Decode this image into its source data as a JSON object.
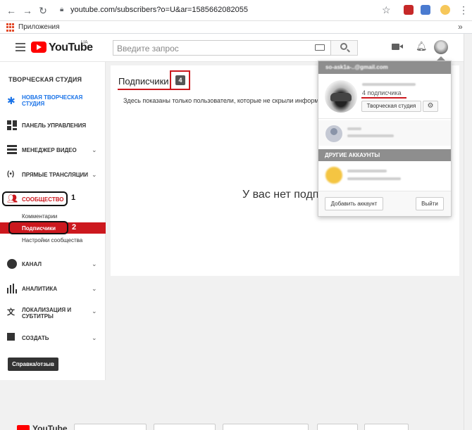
{
  "browser": {
    "url": "youtube.com/subscribers?o=U&ar=1585662082055",
    "bookmarks_label": "Приложения",
    "more_glyph": "»"
  },
  "header": {
    "logo_text": "YouTube",
    "logo_region": "UA",
    "search_placeholder": "Введите запрос"
  },
  "sidebar": {
    "title": "ТВОРЧЕСКАЯ СТУДИЯ",
    "items": [
      {
        "label": "НОВАЯ ТВОРЧЕСКАЯ СТУДИЯ",
        "icon": "gear-icon"
      },
      {
        "label": "ПАНЕЛЬ УПРАВЛЕНИЯ",
        "icon": "dashboard-icon"
      },
      {
        "label": "МЕНЕДЖЕР ВИДЕО",
        "icon": "video-manager-icon"
      },
      {
        "label": "ПРЯМЫЕ ТРАНСЛЯЦИИ",
        "icon": "live-icon"
      },
      {
        "label": "СООБЩЕСТВО",
        "icon": "community-icon"
      },
      {
        "label": "КАНАЛ",
        "icon": "channel-icon"
      },
      {
        "label": "АНАЛИТИКА",
        "icon": "analytics-icon"
      },
      {
        "label": "ЛОКАЛИЗАЦИЯ И СУБТИТРЫ",
        "icon": "translate-icon"
      },
      {
        "label": "СОЗДАТЬ",
        "icon": "create-icon"
      }
    ],
    "community_sub": [
      "Комментарии",
      "Подписчики",
      "Настройки сообщества"
    ],
    "help_button": "Справка/отзыв"
  },
  "annotations": {
    "one": "1",
    "two": "2"
  },
  "main": {
    "title": "Подписчики",
    "count": "4",
    "description": "Здесь показаны только пользователи, которые не скрыли информацию о своих подписках.",
    "empty_message": "У вас нет подписчиков"
  },
  "account_popup": {
    "email": "so-ask1a-..@gmail.com",
    "subscribers": "4 подписчика",
    "studio_button": "Творческая студия",
    "other_accounts_label": "ДРУГИЕ АККАУНТЫ",
    "add_account_button": "Добавить аккаунт",
    "logout_button": "Выйти"
  },
  "colors": {
    "accent": "#cc181e",
    "youtube_red": "#ff0000"
  }
}
